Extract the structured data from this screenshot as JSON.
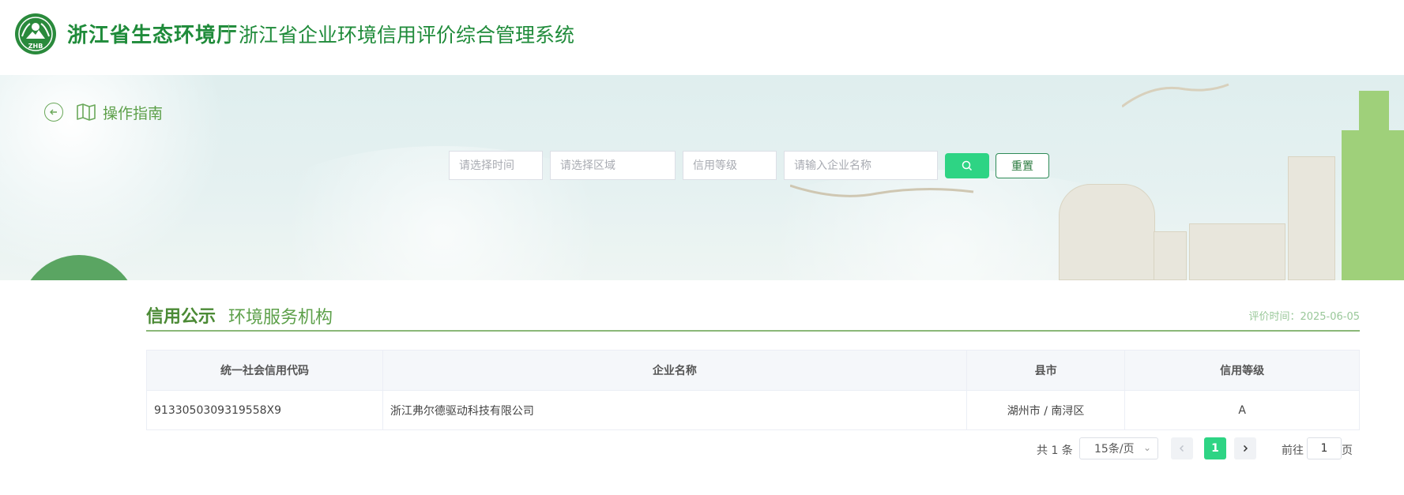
{
  "header": {
    "department": "浙江省生态环境厅",
    "system_title": "浙江省企业环境信用评价综合管理系统",
    "logo_text": "ZHB"
  },
  "nav": {
    "back_icon": "arrow-left-circle-icon",
    "guide_icon": "map-icon",
    "guide_label": "操作指南"
  },
  "filters": {
    "time_placeholder": "请选择时间",
    "region_placeholder": "请选择区域",
    "level_placeholder": "信用等级",
    "name_placeholder": "请输入企业名称",
    "search_icon": "search-icon",
    "reset_label": "重置"
  },
  "section": {
    "title": "信用公示",
    "subtitle": "环境服务机构",
    "eval_time": "评价时间：2025-06-05"
  },
  "table": {
    "columns": [
      "统一社会信用代码",
      "企业名称",
      "县市",
      "信用等级"
    ],
    "rows": [
      [
        "9133050309319558X9",
        "浙江弗尔德驱动科技有限公司",
        "湖州市 / 南浔区",
        "A"
      ]
    ]
  },
  "pagination": {
    "total": "共 1 条",
    "page_size": "15条/页",
    "current_page": "1",
    "goto_label": "前往",
    "goto_value": "1",
    "page_unit": "页"
  },
  "colors": {
    "brand_green": "#1f8b3a",
    "accent_green": "#2ed484",
    "section_green": "#5da04a"
  }
}
